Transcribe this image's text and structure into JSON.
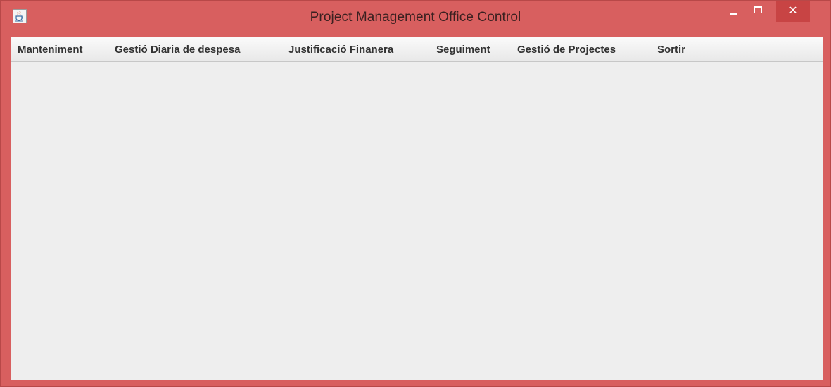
{
  "window": {
    "title": "Project Management Office Control",
    "app_icon": "java-cup-icon",
    "controls": {
      "minimize_icon": "minimize-icon",
      "maximize_icon": "maximize-icon",
      "close_icon": "close-icon",
      "close_glyph": "✕"
    },
    "colors": {
      "frame": "#d85f5f",
      "close_button": "#c84444",
      "content_background": "#eeeeee"
    }
  },
  "menubar": {
    "items": [
      {
        "label": "Manteniment"
      },
      {
        "label": "Gestió Diaria de despesa"
      },
      {
        "label": "Justificació Finanera"
      },
      {
        "label": "Seguiment"
      },
      {
        "label": "Gestió de Projectes"
      },
      {
        "label": "Sortir"
      }
    ]
  }
}
